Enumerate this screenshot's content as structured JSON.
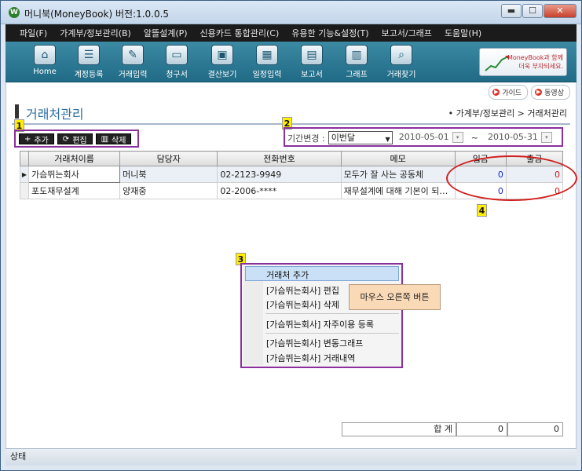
{
  "window": {
    "title": "머니북(MoneyBook) 버전:1.0.0.5",
    "app_icon": "W",
    "buttons": {
      "minimize": "▬",
      "maximize": "☐",
      "close": "✕"
    }
  },
  "menu": [
    "파일(F)",
    "가계부/정보관리(B)",
    "알뜰설계(P)",
    "신용카드 통합관리(C)",
    "유용한 기능&설정(T)",
    "보고서/그래프",
    "도움말(H)"
  ],
  "toolbar": [
    {
      "label": "Home",
      "icon": "home-icon"
    },
    {
      "label": "계정등록",
      "icon": "account-icon"
    },
    {
      "label": "거래입력",
      "icon": "edit-icon"
    },
    {
      "label": "청구서",
      "icon": "card-icon"
    },
    {
      "label": "결산보기",
      "icon": "monitor-icon"
    },
    {
      "label": "일정입력",
      "icon": "calendar-icon"
    },
    {
      "label": "보고서",
      "icon": "report-icon"
    },
    {
      "label": "그래프",
      "icon": "graph-icon"
    },
    {
      "label": "거래찾기",
      "icon": "search-icon"
    }
  ],
  "banner": {
    "line1": "MoneyBook과 함께",
    "line2": "더욱 부자되세요."
  },
  "guide": {
    "guide_label": "가이드",
    "video_label": "동영상"
  },
  "page": {
    "title": "거래처관리",
    "breadcrumb": "• 가계부/정보관리 > 거래처관리"
  },
  "callouts": [
    "1",
    "2",
    "3",
    "4"
  ],
  "actions": {
    "add": "추가",
    "edit": "편집",
    "delete": "삭제"
  },
  "period": {
    "label": "기간변경 :",
    "selected": "이번달",
    "start_date": "2010-05-01",
    "separator": "~",
    "end_date": "2010-05-31"
  },
  "grid": {
    "columns": [
      "거래처이름",
      "담당자",
      "전화번호",
      "메모",
      "입금",
      "출금"
    ],
    "rows": [
      [
        "가슴뛰는회사",
        "머니북",
        "02-2123-9949",
        "모두가 잘 사는 공동체",
        "0",
        "0"
      ],
      [
        "포도재무설계",
        "양재중",
        "02-2006-****",
        "재무설계에 대해 기본이 되…",
        "0",
        "0"
      ]
    ]
  },
  "context_menu": {
    "items": [
      "거래처 추가",
      "[가슴뛰는회사] 편집",
      "[가슴뛰는회사] 삭제",
      "[가슴뛰는회사] 자주이용 등록",
      "[가슴뛰는회사] 변동그래프",
      "[가슴뛰는회사] 거래내역"
    ]
  },
  "tooltip": "마우스 오른쪽 버튼",
  "totals": {
    "label": "합 계",
    "in": "0",
    "out": "0"
  },
  "status": "상태",
  "colors": {
    "accent": "#2b6fa6",
    "toolbar": "#206a86",
    "highlight": "#8a2f9d",
    "ellipse": "#d11f1f",
    "callout": "#ffee00"
  }
}
